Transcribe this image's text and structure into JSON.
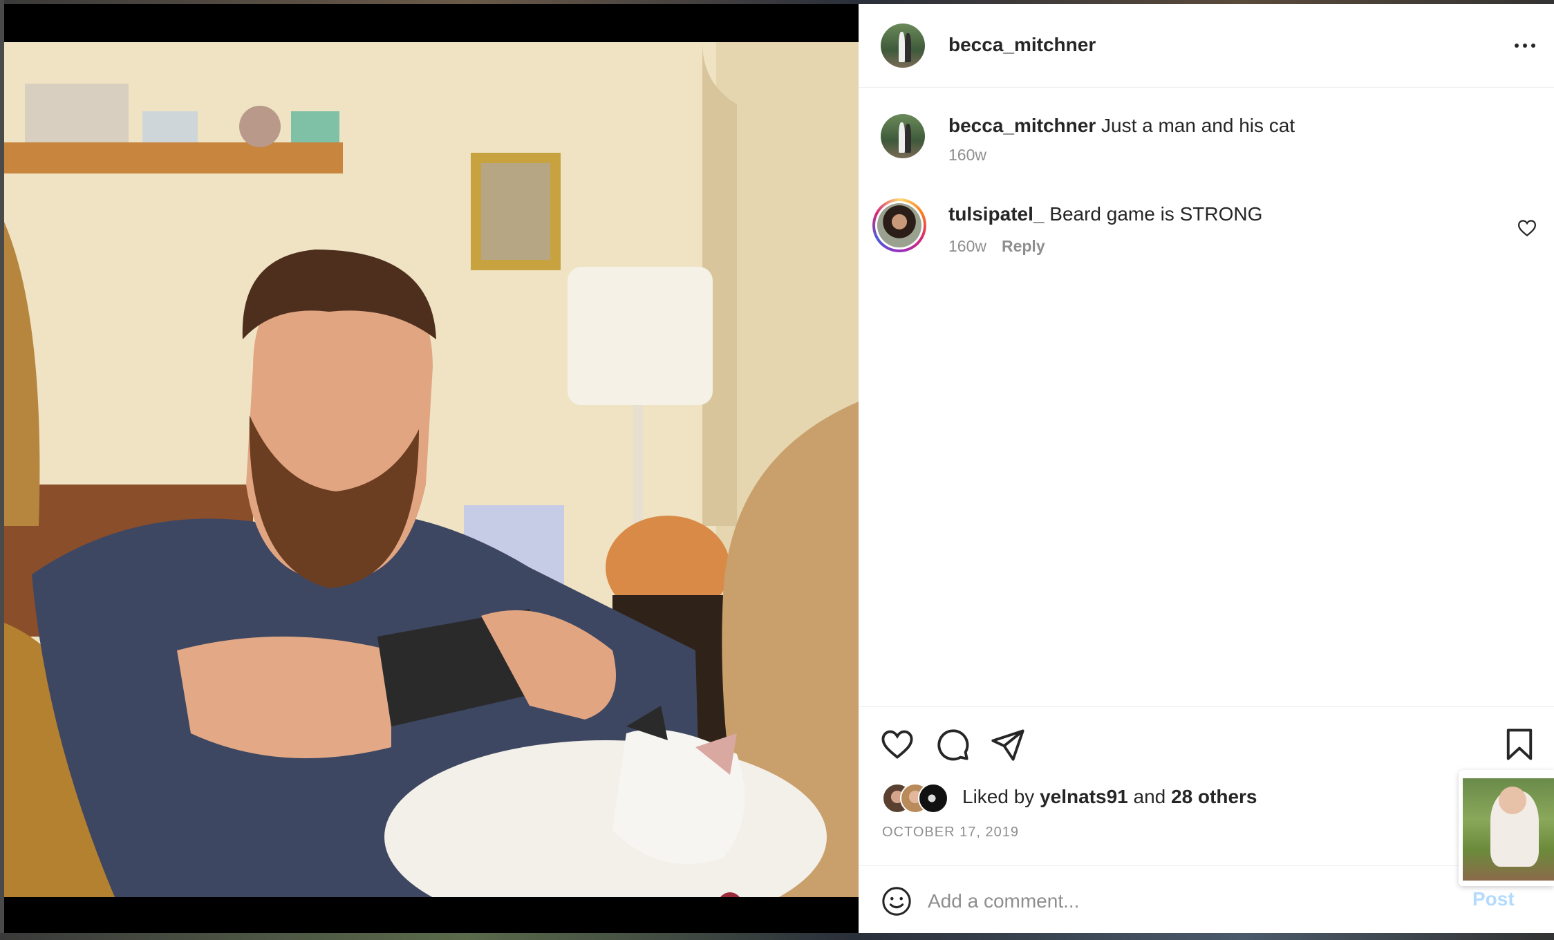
{
  "post": {
    "username": "becca_mitchner",
    "caption": "Just a man and his cat",
    "caption_age": "160w",
    "date": "OCTOBER 17, 2019"
  },
  "comments": [
    {
      "username": "tulsipatel_",
      "text": "Beard game is STRONG",
      "age": "160w",
      "reply_label": "Reply"
    }
  ],
  "likes": {
    "prefix": "Liked by",
    "first_user": "yelnats91",
    "joiner": "and",
    "others": "28 others"
  },
  "add_comment": {
    "placeholder": "Add a comment...",
    "post_label": "Post"
  },
  "icons": {
    "more": "more-horizontal-icon",
    "like": "heart-icon",
    "comment": "comment-icon",
    "share": "send-icon",
    "save": "bookmark-icon",
    "emoji": "emoji-icon"
  },
  "colors": {
    "text": "#262626",
    "muted": "#8e8e8e",
    "post_disabled": "#b3dbff",
    "divider": "#efefef"
  }
}
